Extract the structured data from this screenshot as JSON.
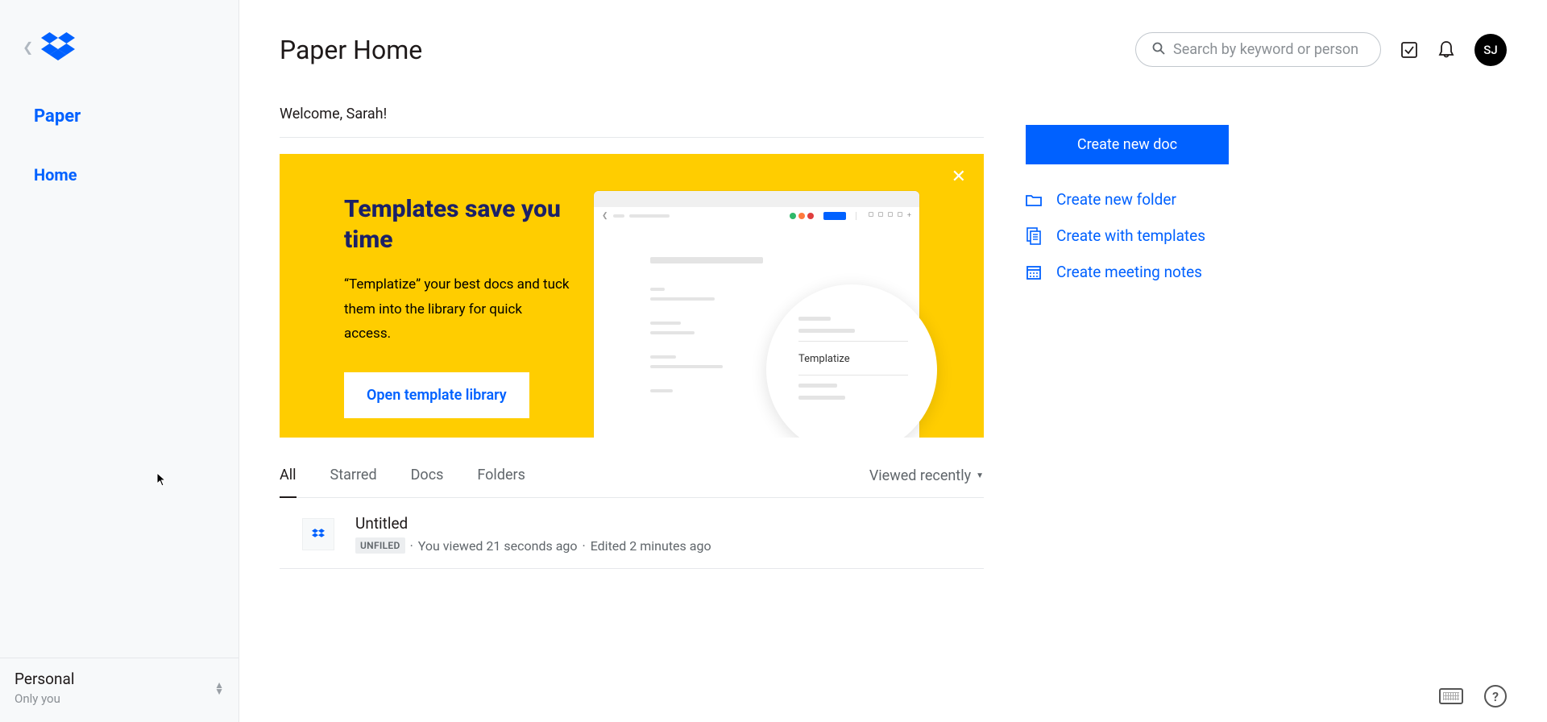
{
  "header": {
    "title": "Paper Home",
    "search_placeholder": "Search by keyword or person",
    "avatar_initials": "SJ"
  },
  "sidebar": {
    "app_name": "Paper",
    "nav_home": "Home",
    "account_name": "Personal",
    "account_sub": "Only you"
  },
  "welcome": "Welcome, Sarah!",
  "banner": {
    "title": "Templates save you time",
    "body": "“Templatize” your best docs and tuck them into the library for quick access.",
    "button": "Open template library",
    "circle_label": "Templatize"
  },
  "tabs": {
    "items": [
      "All",
      "Starred",
      "Docs",
      "Folders"
    ],
    "sort_label": "Viewed recently"
  },
  "docs": [
    {
      "title": "Untitled",
      "badge": "UNFILED",
      "viewed": "You viewed 21 seconds ago",
      "edited": "Edited 2 minutes ago"
    }
  ],
  "actions": {
    "create_doc": "Create new doc",
    "create_folder": "Create new folder",
    "create_templates": "Create with templates",
    "create_meeting": "Create meeting notes"
  },
  "colors": {
    "primary": "#0061ff",
    "banner_bg": "#ffcd00",
    "banner_title": "#1b2167"
  }
}
